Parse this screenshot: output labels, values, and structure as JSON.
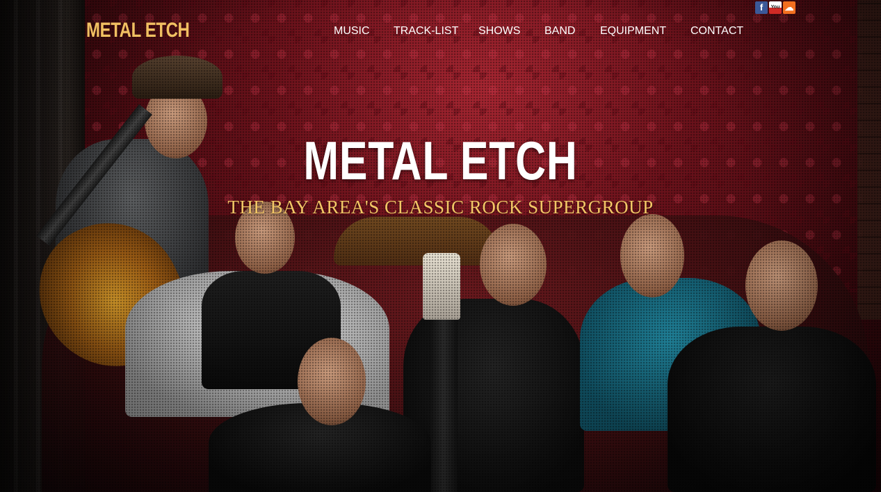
{
  "header": {
    "brand": "METAL ETCH",
    "nav": [
      {
        "label": "MUSIC"
      },
      {
        "label": "TRACK-LIST"
      },
      {
        "label": "SHOWS"
      },
      {
        "label": "BAND"
      },
      {
        "label": "EQUIPMENT"
      },
      {
        "label": "CONTACT"
      }
    ],
    "social": [
      {
        "icon": "facebook-icon",
        "glyph": "f",
        "color": "#3b5998"
      },
      {
        "icon": "youtube-icon",
        "glyph": "You",
        "color": "#d12a25"
      },
      {
        "icon": "soundcloud-icon",
        "glyph": "☁",
        "color": "#f26f1f"
      }
    ]
  },
  "hero": {
    "title": "METAL ETCH",
    "subtitle": "THE BAY AREA'S CLASSIC ROCK SUPERGROUP",
    "title_color": "#ffffff",
    "subtitle_color": "#f3c766",
    "brand_color": "#f1c062"
  }
}
